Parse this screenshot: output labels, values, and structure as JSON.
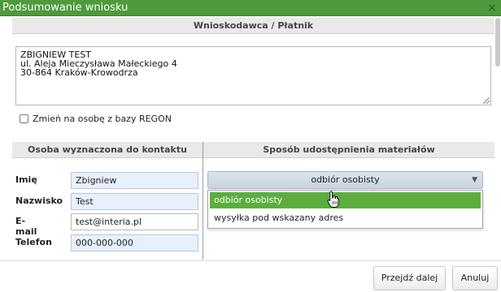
{
  "window": {
    "title": "Podsumowanie wniosku",
    "close_symbol": "×"
  },
  "applicant": {
    "header": "Wnioskodawca / Płatnik",
    "address_lines": [
      "ZBIGNIEW TEST",
      "ul. Aleja Mieczysława Małeckiego 4",
      "30-864 Kraków-Krowodrza"
    ],
    "regon_checkbox_label": "Zmień na osobę z bazy REGON",
    "regon_checked": false
  },
  "contact": {
    "header": "Osoba wyznaczona do kontaktu",
    "fields": [
      {
        "label": "Imię",
        "value": "Zbigniew"
      },
      {
        "label": "Nazwisko",
        "value": "Test"
      },
      {
        "label": "E-mail",
        "value": "test@interia.pl"
      },
      {
        "label": "Telefon",
        "value": "000-000-000"
      }
    ]
  },
  "delivery": {
    "header": "Sposób udostępnienia materiałów",
    "selected": "odbiór osobisty",
    "options": [
      "odbiór osobisty",
      "wysyłka pod wskazany adres"
    ]
  },
  "buttons": {
    "next": "Przejdź dalej",
    "cancel": "Anuluj"
  },
  "colors": {
    "titlebar": "#4e9a3d",
    "selected_option": "#5bae3e"
  }
}
